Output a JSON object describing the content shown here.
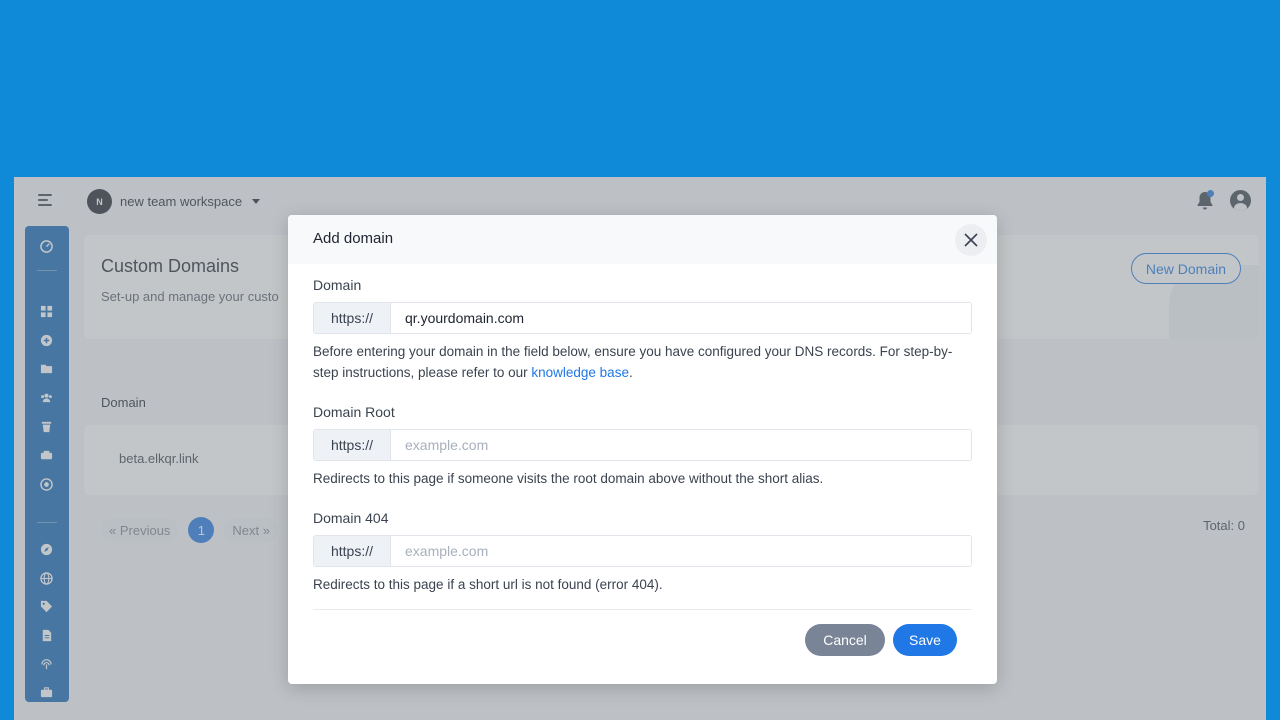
{
  "header": {
    "workspace_initial": "N",
    "workspace_name": "new team workspace"
  },
  "page": {
    "title": "Custom Domains",
    "subtitle": "Set-up and manage your custo",
    "new_domain_label": "New Domain"
  },
  "table": {
    "columns": [
      "Domain"
    ],
    "rows": [
      {
        "domain": "beta.elkqr.link"
      }
    ]
  },
  "pagination": {
    "previous_label": "« Previous",
    "current_page": "1",
    "next_label": "Next »",
    "total_label": "Total: 0"
  },
  "modal": {
    "title": "Add domain",
    "domain": {
      "label": "Domain",
      "prefix": "https://",
      "value": "qr.yourdomain.com",
      "help_before": "Before entering your domain in the field below, ensure you have configured your DNS records. For step-by-step instructions, please refer to our ",
      "help_link": "knowledge base",
      "help_after": "."
    },
    "domain_root": {
      "label": "Domain Root",
      "prefix": "https://",
      "placeholder": "example.com",
      "help": "Redirects to this page if someone visits the root domain above without the short alias."
    },
    "domain_404": {
      "label": "Domain 404",
      "prefix": "https://",
      "placeholder": "example.com",
      "help": "Redirects to this page if a short url is not found (error 404)."
    },
    "cancel_label": "Cancel",
    "save_label": "Save"
  },
  "colors": {
    "background": "#0e8ad9",
    "sidebar": "#1467b8",
    "accent": "#1f78e5",
    "cancel": "#7a8497"
  }
}
